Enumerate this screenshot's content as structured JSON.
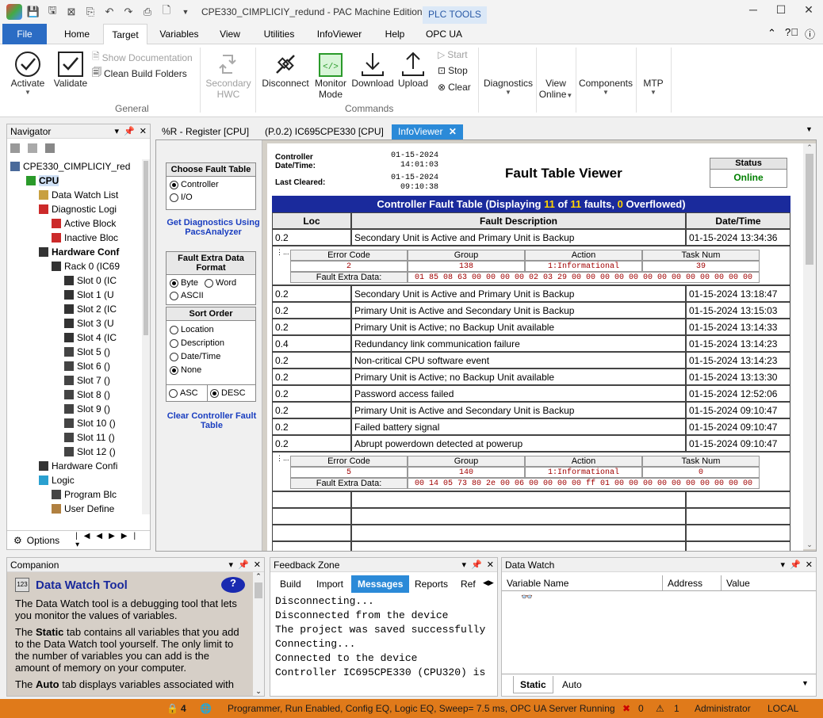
{
  "title": "CPE330_CIMPLICIY_redund - PAC Machine Edition",
  "plc_tools": "PLC TOOLS",
  "ribbon_tabs": [
    "File",
    "Home",
    "Target",
    "Variables",
    "View",
    "Utilities",
    "InfoViewer",
    "Help",
    "OPC UA"
  ],
  "ribbon": {
    "activate": "Activate",
    "validate": "Validate",
    "show_doc": "Show Documentation",
    "clean_build": "Clean Build Folders",
    "general": "General",
    "secondary_hwc_1": "Secondary",
    "secondary_hwc_2": "HWC",
    "disconnect": "Disconnect",
    "monitor_mode_1": "Monitor",
    "monitor_mode_2": "Mode",
    "download": "Download",
    "upload": "Upload",
    "start": "Start",
    "stop": "Stop",
    "clear": "Clear",
    "commands": "Commands",
    "diagnostics": "Diagnostics",
    "view_online_1": "View",
    "view_online_2": "Online",
    "components": "Components",
    "mtp": "MTP"
  },
  "navigator": {
    "title": "Navigator",
    "options": "Options",
    "items": [
      "CPE330_CIMPLICIY_red",
      "CPU",
      "Data Watch List",
      "Diagnostic Logi",
      "Active Block",
      "Inactive Bloc",
      "Hardware Conf",
      "Rack 0 (IC69",
      "Slot 0 (IC",
      "Slot 1 (U",
      "Slot 2 (IC",
      "Slot 3 (U",
      "Slot 4 (IC",
      "Slot 5 ()",
      "Slot 6 ()",
      "Slot 7 ()",
      "Slot 8 ()",
      "Slot 9 ()",
      "Slot 10 ()",
      "Slot 11 ()",
      "Slot 12 ()",
      "Hardware Confi",
      "Logic",
      "Program Blc",
      "User Define"
    ]
  },
  "doc_tabs": [
    "%R - Register [CPU]",
    "(P.0.2) IC695CPE330 [CPU]",
    "InfoViewer"
  ],
  "left_controls": {
    "choose_fault_table": "Choose Fault Table",
    "controller": "Controller",
    "io": "I/O",
    "get_diag": "Get Diagnostics Using PacsAnalyzer",
    "extra_data_format": "Fault Extra Data Format",
    "byte": "Byte",
    "word": "Word",
    "ascii": "ASCII",
    "sort_order": "Sort Order",
    "location": "Location",
    "description": "Description",
    "date_time": "Date/Time",
    "none": "None",
    "asc": "ASC",
    "desc": "DESC",
    "clear_table": "Clear Controller Fault Table"
  },
  "report": {
    "controller_dt_label_1": "Controller",
    "controller_dt_label_2": "Date/Time:",
    "controller_date": "01-15-2024",
    "controller_time": "14:01:03",
    "last_cleared_label": "Last Cleared:",
    "cleared_date": "01-15-2024",
    "cleared_time": "09:10:38",
    "viewer_title": "Fault Table Viewer",
    "status_label": "Status",
    "status_value": "Online",
    "table_title_pre": "Controller Fault Table (Displaying ",
    "displaying": "11",
    "of": " of ",
    "total": "11",
    "faults": " faults, ",
    "overflowed": "0",
    "overflowed_suffix": " Overflowed)",
    "col_loc": "Loc",
    "col_desc": "Fault Description",
    "col_dt": "Date/Time",
    "sub_headers": [
      "Error Code",
      "Group",
      "Action",
      "Task Num"
    ],
    "extra_label": "Fault Extra Data:",
    "faults_list": [
      {
        "loc": "0.2",
        "desc": "Secondary Unit is Active and Primary Unit is Backup",
        "dt": "01-15-2024 13:34:36"
      },
      {
        "loc": "0.2",
        "desc": "Secondary Unit is Active and Primary Unit is Backup",
        "dt": "01-15-2024 13:18:47"
      },
      {
        "loc": "0.2",
        "desc": "Primary Unit is Active and Secondary Unit is Backup",
        "dt": "01-15-2024 13:15:03"
      },
      {
        "loc": "0.2",
        "desc": "Primary Unit is Active; no Backup Unit available",
        "dt": "01-15-2024 13:14:33"
      },
      {
        "loc": "0.4",
        "desc": "Redundancy link communication failure",
        "dt": "01-15-2024 13:14:23"
      },
      {
        "loc": "0.2",
        "desc": "Non-critical CPU software event",
        "dt": "01-15-2024 13:14:23"
      },
      {
        "loc": "0.2",
        "desc": "Primary Unit is Active; no Backup Unit available",
        "dt": "01-15-2024 13:13:30"
      },
      {
        "loc": "0.2",
        "desc": "Password access failed",
        "dt": "01-15-2024 12:52:06"
      },
      {
        "loc": "0.2",
        "desc": "Primary Unit is Active and Secondary Unit is Backup",
        "dt": "01-15-2024 09:10:47"
      },
      {
        "loc": "0.2",
        "desc": "Failed battery signal",
        "dt": "01-15-2024 09:10:47"
      },
      {
        "loc": "0.2",
        "desc": "Abrupt powerdown detected at powerup",
        "dt": "01-15-2024 09:10:47"
      }
    ],
    "detail1": {
      "error_code": "2",
      "group": "138",
      "action": "1:Informational",
      "task": "39",
      "extra": "01 85 08 63 00 00 00 00 02 03 29 00 00 00 00 00 00 00 00 00 00 00 00 00"
    },
    "detail2": {
      "error_code": "5",
      "group": "140",
      "action": "1:Informational",
      "task": "0",
      "extra": "00 14 05 73 80 2e 00 06 00 00 00 00 ff 01 00 00 00 00 00 00 00 00 00 00"
    }
  },
  "companion": {
    "title": "Companion",
    "heading": "Data Watch Tool",
    "p1": "The Data Watch tool is a debugging tool that lets you monitor the values of variables.",
    "p2_pre": "The ",
    "p2_bold": "Static",
    "p2_post": " tab contains all variables that you add to the Data Watch tool yourself. The only limit to the number of variables you can add is the amount of memory on your computer.",
    "p3_pre": "The ",
    "p3_bold": "Auto",
    "p3_post": " tab displays variables associated with"
  },
  "feedback": {
    "title": "Feedback Zone",
    "tabs": [
      "Build",
      "Import",
      "Messages",
      "Reports",
      "Ref"
    ],
    "lines": [
      "Disconnecting...",
      "Disconnected from the device",
      "The project was saved successfully",
      "Connecting...",
      "Connected to the device",
      "Controller IC695CPE330 (CPU320) is"
    ]
  },
  "datawatch": {
    "title": "Data Watch",
    "cols": [
      "Variable Name",
      "Address",
      "Value"
    ],
    "tabs": [
      "Static",
      "Auto"
    ]
  },
  "status": {
    "lock_count": "4",
    "text": "Programmer, Run Enabled, Config EQ, Logic EQ, Sweep=  7.5 ms, OPC UA Server Running",
    "errors": "0",
    "warnings": "1",
    "user": "Administrator",
    "location": "LOCAL"
  },
  "colors": {
    "accent": "#2b6cc4",
    "fault_header": "#1a2a9c",
    "status_bar": "#e07a1a",
    "online": "#008000"
  }
}
